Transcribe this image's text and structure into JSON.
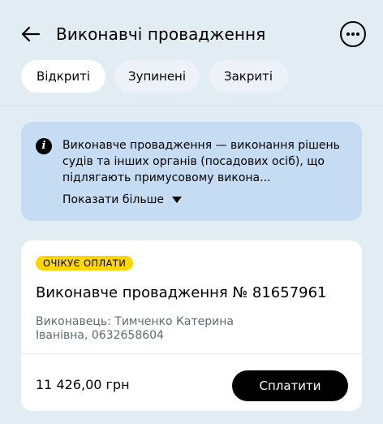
{
  "header": {
    "title": "Виконавчі провадження",
    "back_icon": "arrow-left-icon",
    "more_icon": "more-horizontal-icon"
  },
  "tabs": [
    {
      "label": "Відкриті",
      "active": true
    },
    {
      "label": "Зупинені",
      "active": false
    },
    {
      "label": "Закриті",
      "active": false
    }
  ],
  "info": {
    "icon": "info-icon",
    "text": "Виконавче провадження — виконання рішень судів та інших органів (посадових осіб), що підлягають примусовому викона...",
    "show_more": "Показати більше"
  },
  "card": {
    "badge": "ОЧІКУЄ ОПЛАТИ",
    "title": "Виконавче провадження № 81657961",
    "subtitle": "Виконавець: Тимченко Катерина Іванівна, 0632658604",
    "amount": "11 426,00 грн",
    "pay_label": "Сплатити"
  },
  "colors": {
    "background": "#e2ecf3",
    "info_bg": "#c5dcf3",
    "badge_bg": "#ffd600",
    "button_bg": "#000000"
  }
}
